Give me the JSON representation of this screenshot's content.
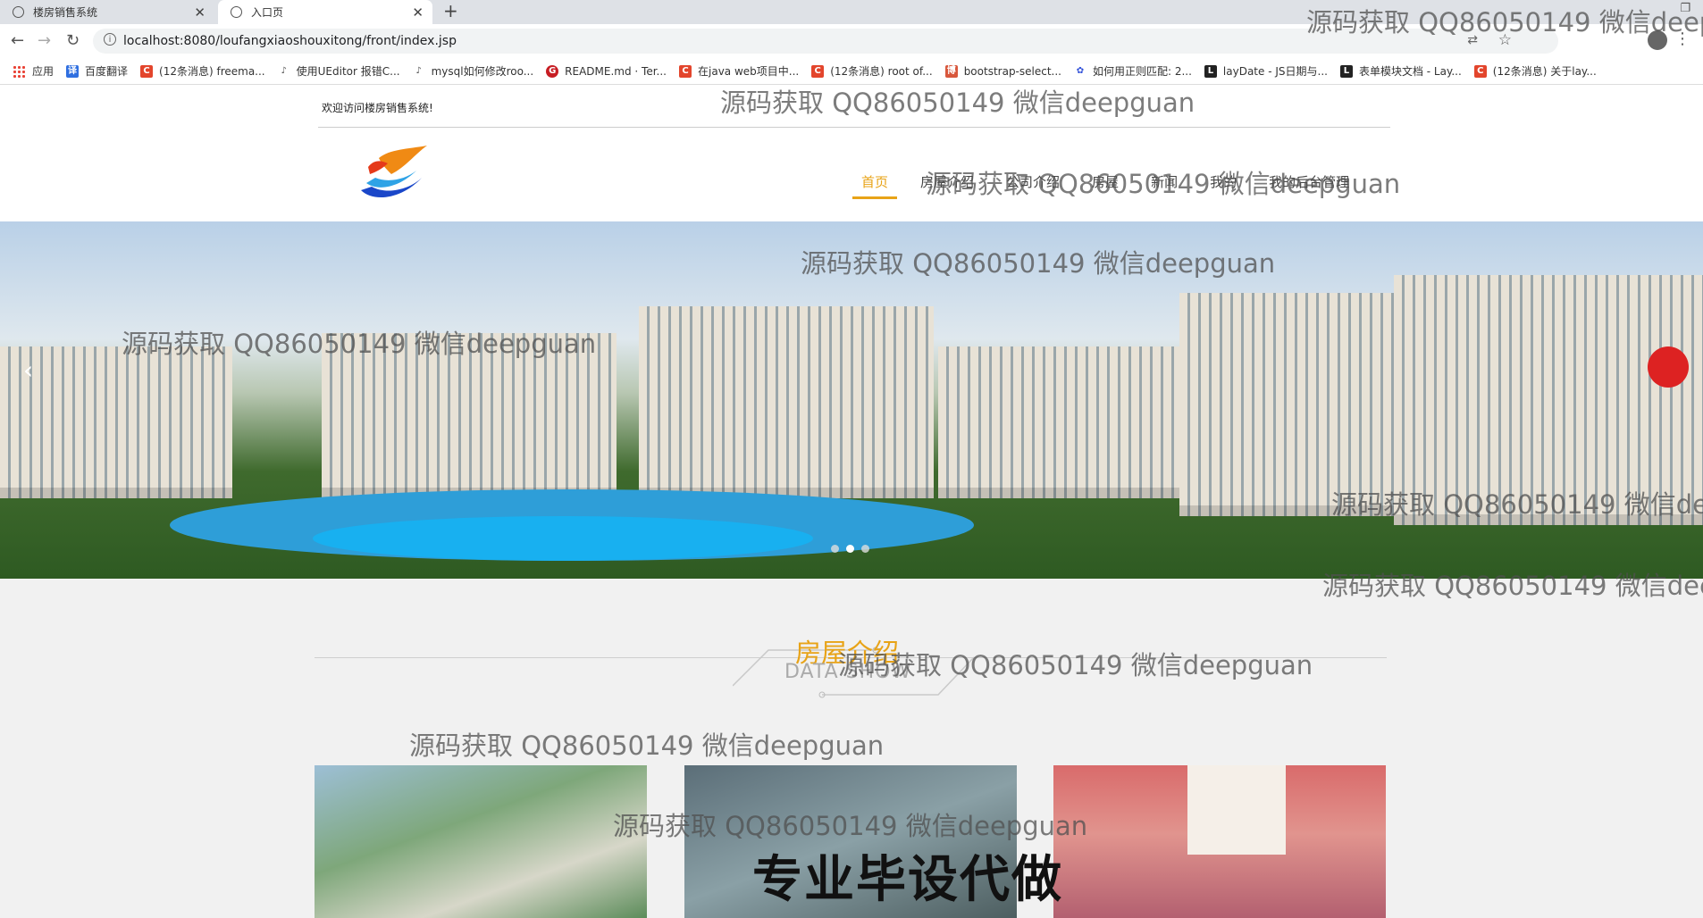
{
  "browser": {
    "tabs": [
      {
        "label": "楼房销售系统",
        "active": false
      },
      {
        "label": "入口页",
        "active": true
      }
    ],
    "new_tab": "+",
    "url": "localhost:8080/loufangxiaoshouxitong/front/index.jsp",
    "bookmarks": [
      {
        "label": "应用",
        "icon": "apps-icon"
      },
      {
        "label": "百度翻译",
        "icon": "translate-icon"
      },
      {
        "label": "(12条消息) freema...",
        "icon": "csdn-icon"
      },
      {
        "label": "使用UEditor 报错C...",
        "icon": "link-icon"
      },
      {
        "label": "mysql如何修改roo...",
        "icon": "link-icon"
      },
      {
        "label": "README.md · Ter...",
        "icon": "gitee-icon"
      },
      {
        "label": "在java web项目中...",
        "icon": "csdn-icon"
      },
      {
        "label": "(12条消息) root of...",
        "icon": "csdn-icon"
      },
      {
        "label": "bootstrap-select...",
        "icon": "cnblogs-icon"
      },
      {
        "label": "如何用正则匹配: 2...",
        "icon": "baidu-icon"
      },
      {
        "label": "layDate - JS日期与...",
        "icon": "layui-icon"
      },
      {
        "label": "表单模块文档 - Lay...",
        "icon": "layui-icon"
      },
      {
        "label": "(12条消息) 关于lay...",
        "icon": "csdn-icon"
      }
    ]
  },
  "site": {
    "welcome": "欢迎访问楼房销售系统!",
    "nav": [
      {
        "label": "首页",
        "active": true
      },
      {
        "label": "房屋介绍",
        "active": false
      },
      {
        "label": "公司介绍",
        "active": false
      },
      {
        "label": "房屋",
        "active": false
      },
      {
        "label": "新闻",
        "active": false
      },
      {
        "label": "我的",
        "active": false
      },
      {
        "label": "我的后台管理",
        "active": false
      }
    ],
    "carousel": {
      "slides": 3,
      "current": 2
    },
    "section": {
      "title": "房屋介绍",
      "subtitle": "DATA SHOW"
    },
    "promo": "专业毕设代做"
  },
  "watermark": "源码获取 QQ86050149 微信deepguan",
  "colors": {
    "accent": "#e8a317",
    "carousel_button": "#dd2222"
  }
}
